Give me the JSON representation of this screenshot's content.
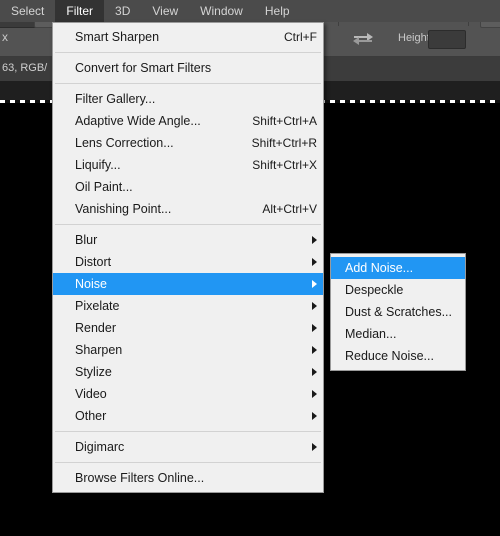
{
  "menubar": {
    "items": [
      {
        "label": "Select",
        "active": false
      },
      {
        "label": "Filter",
        "active": true
      },
      {
        "label": "3D",
        "active": false
      },
      {
        "label": "View",
        "active": false
      },
      {
        "label": "Window",
        "active": false
      },
      {
        "label": "Help",
        "active": false
      }
    ]
  },
  "options_bar": {
    "close_glyph": "x",
    "swap_icon": "swap-arrows-icon",
    "height_label": "Height:",
    "height_value": ""
  },
  "status_bar": {
    "text": "63, RGB/"
  },
  "filter_menu": {
    "groups": [
      {
        "items": [
          {
            "label": "Smart Sharpen",
            "shortcut": "Ctrl+F",
            "submenu": false,
            "highlight": false
          }
        ]
      },
      {
        "items": [
          {
            "label": "Convert for Smart Filters",
            "shortcut": "",
            "submenu": false,
            "highlight": false
          }
        ]
      },
      {
        "items": [
          {
            "label": "Filter Gallery...",
            "shortcut": "",
            "submenu": false,
            "highlight": false
          },
          {
            "label": "Adaptive Wide Angle...",
            "shortcut": "Shift+Ctrl+A",
            "submenu": false,
            "highlight": false
          },
          {
            "label": "Lens Correction...",
            "shortcut": "Shift+Ctrl+R",
            "submenu": false,
            "highlight": false
          },
          {
            "label": "Liquify...",
            "shortcut": "Shift+Ctrl+X",
            "submenu": false,
            "highlight": false
          },
          {
            "label": "Oil Paint...",
            "shortcut": "",
            "submenu": false,
            "highlight": false
          },
          {
            "label": "Vanishing Point...",
            "shortcut": "Alt+Ctrl+V",
            "submenu": false,
            "highlight": false
          }
        ]
      },
      {
        "items": [
          {
            "label": "Blur",
            "shortcut": "",
            "submenu": true,
            "highlight": false
          },
          {
            "label": "Distort",
            "shortcut": "",
            "submenu": true,
            "highlight": false
          },
          {
            "label": "Noise",
            "shortcut": "",
            "submenu": true,
            "highlight": true
          },
          {
            "label": "Pixelate",
            "shortcut": "",
            "submenu": true,
            "highlight": false
          },
          {
            "label": "Render",
            "shortcut": "",
            "submenu": true,
            "highlight": false
          },
          {
            "label": "Sharpen",
            "shortcut": "",
            "submenu": true,
            "highlight": false
          },
          {
            "label": "Stylize",
            "shortcut": "",
            "submenu": true,
            "highlight": false
          },
          {
            "label": "Video",
            "shortcut": "",
            "submenu": true,
            "highlight": false
          },
          {
            "label": "Other",
            "shortcut": "",
            "submenu": true,
            "highlight": false
          }
        ]
      },
      {
        "items": [
          {
            "label": "Digimarc",
            "shortcut": "",
            "submenu": true,
            "highlight": false
          }
        ]
      },
      {
        "items": [
          {
            "label": "Browse Filters Online...",
            "shortcut": "",
            "submenu": false,
            "highlight": false
          }
        ]
      }
    ]
  },
  "noise_submenu": {
    "items": [
      {
        "label": "Add Noise...",
        "highlight": true
      },
      {
        "label": "Despeckle",
        "highlight": false
      },
      {
        "label": "Dust & Scratches...",
        "highlight": false
      },
      {
        "label": "Median...",
        "highlight": false
      },
      {
        "label": "Reduce Noise...",
        "highlight": false
      }
    ]
  },
  "colors": {
    "highlight": "#2196f3",
    "menu_background": "#f0f0f0",
    "menubar_background": "#4b4b4b",
    "canvas": "#000000"
  }
}
